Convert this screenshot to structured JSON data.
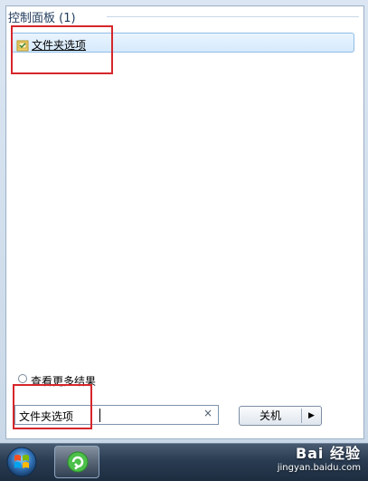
{
  "results": {
    "section_header": "控制面板 (1)",
    "items": [
      {
        "label": "文件夹选项",
        "icon": "folder-options-icon"
      }
    ]
  },
  "see_more": {
    "label": "查看更多结果",
    "icon": "search-icon"
  },
  "search": {
    "value": "文件夹选项",
    "clear": "×"
  },
  "shutdown": {
    "label": "关机",
    "arrow": "▶"
  },
  "watermark": {
    "main": "Bai 经验",
    "url": "jingyan.baidu.com"
  },
  "colors": {
    "highlight": "#d6262b",
    "selection": "#d6eafc"
  }
}
